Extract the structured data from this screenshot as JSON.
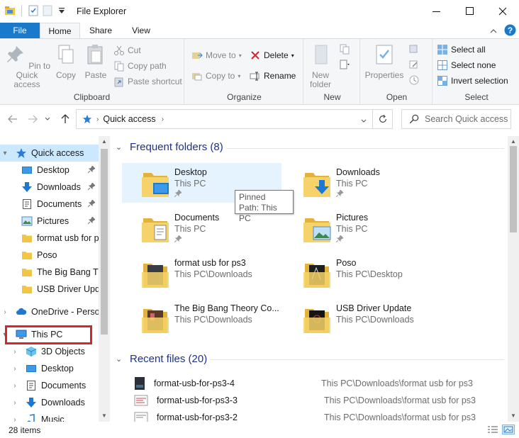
{
  "window": {
    "title": "File Explorer",
    "minimize_glyph": "—",
    "maximize_glyph": "☐",
    "close_glyph": "✕"
  },
  "ribbon_tabs": {
    "file": "File",
    "home": "Home",
    "share": "Share",
    "view": "View"
  },
  "ribbon": {
    "clipboard": {
      "label": "Clipboard",
      "pin_to_quick_access": "Pin to Quick access",
      "copy": "Copy",
      "paste": "Paste",
      "cut": "Cut",
      "copy_path": "Copy path",
      "paste_shortcut": "Paste shortcut"
    },
    "organize": {
      "label": "Organize",
      "move_to": "Move to",
      "copy_to": "Copy to",
      "delete": "Delete",
      "rename": "Rename"
    },
    "new": {
      "label": "New",
      "new_folder": "New folder"
    },
    "open": {
      "label": "Open",
      "properties": "Properties"
    },
    "select": {
      "label": "Select",
      "select_all": "Select all",
      "select_none": "Select none",
      "invert_selection": "Invert selection"
    }
  },
  "address": {
    "location": "Quick access",
    "search_placeholder": "Search Quick access"
  },
  "nav_pane": {
    "quick_access": "Quick access",
    "pinned": [
      {
        "label": "Desktop"
      },
      {
        "label": "Downloads"
      },
      {
        "label": "Documents"
      },
      {
        "label": "Pictures"
      }
    ],
    "recent": [
      {
        "label": "format usb for ps"
      },
      {
        "label": "Poso"
      },
      {
        "label": "The Big Bang Th"
      },
      {
        "label": "USB Driver Upda"
      }
    ],
    "onedrive": "OneDrive - Persor",
    "this_pc": "This PC",
    "this_pc_children": [
      {
        "label": "3D Objects"
      },
      {
        "label": "Desktop"
      },
      {
        "label": "Documents"
      },
      {
        "label": "Downloads"
      },
      {
        "label": "Music"
      }
    ]
  },
  "content": {
    "frequent_header": "Frequent folders (8)",
    "frequent": [
      {
        "name": "Desktop",
        "path": "This PC"
      },
      {
        "name": "Downloads",
        "path": "This PC"
      },
      {
        "name": "Documents",
        "path": "This PC"
      },
      {
        "name": "Pictures",
        "path": "This PC"
      },
      {
        "name": "format usb for ps3",
        "path": "This PC\\Downloads"
      },
      {
        "name": "Poso",
        "path": "This PC\\Desktop"
      },
      {
        "name": "The Big Bang Theory Co...",
        "path": "This PC\\Downloads"
      },
      {
        "name": "USB Driver Update",
        "path": "This PC\\Downloads"
      }
    ],
    "recent_header": "Recent files (20)",
    "recent": [
      {
        "name": "format-usb-for-ps3-4",
        "path": "This PC\\Downloads\\format usb for ps3"
      },
      {
        "name": "format-usb-for-ps3-3",
        "path": "This PC\\Downloads\\format usb for ps3"
      },
      {
        "name": "format-usb-for-ps3-2",
        "path": "This PC\\Downloads\\format usb for ps3"
      }
    ]
  },
  "tooltip": {
    "line1": "Pinned",
    "line2": "Path: This PC"
  },
  "status": {
    "item_count": "28 items"
  },
  "colors": {
    "file_tab": "#1979ca",
    "selection": "#cce8ff",
    "hover": "#e5f3ff",
    "section_header": "#1e3287",
    "highlight_box": "#d6262d"
  }
}
